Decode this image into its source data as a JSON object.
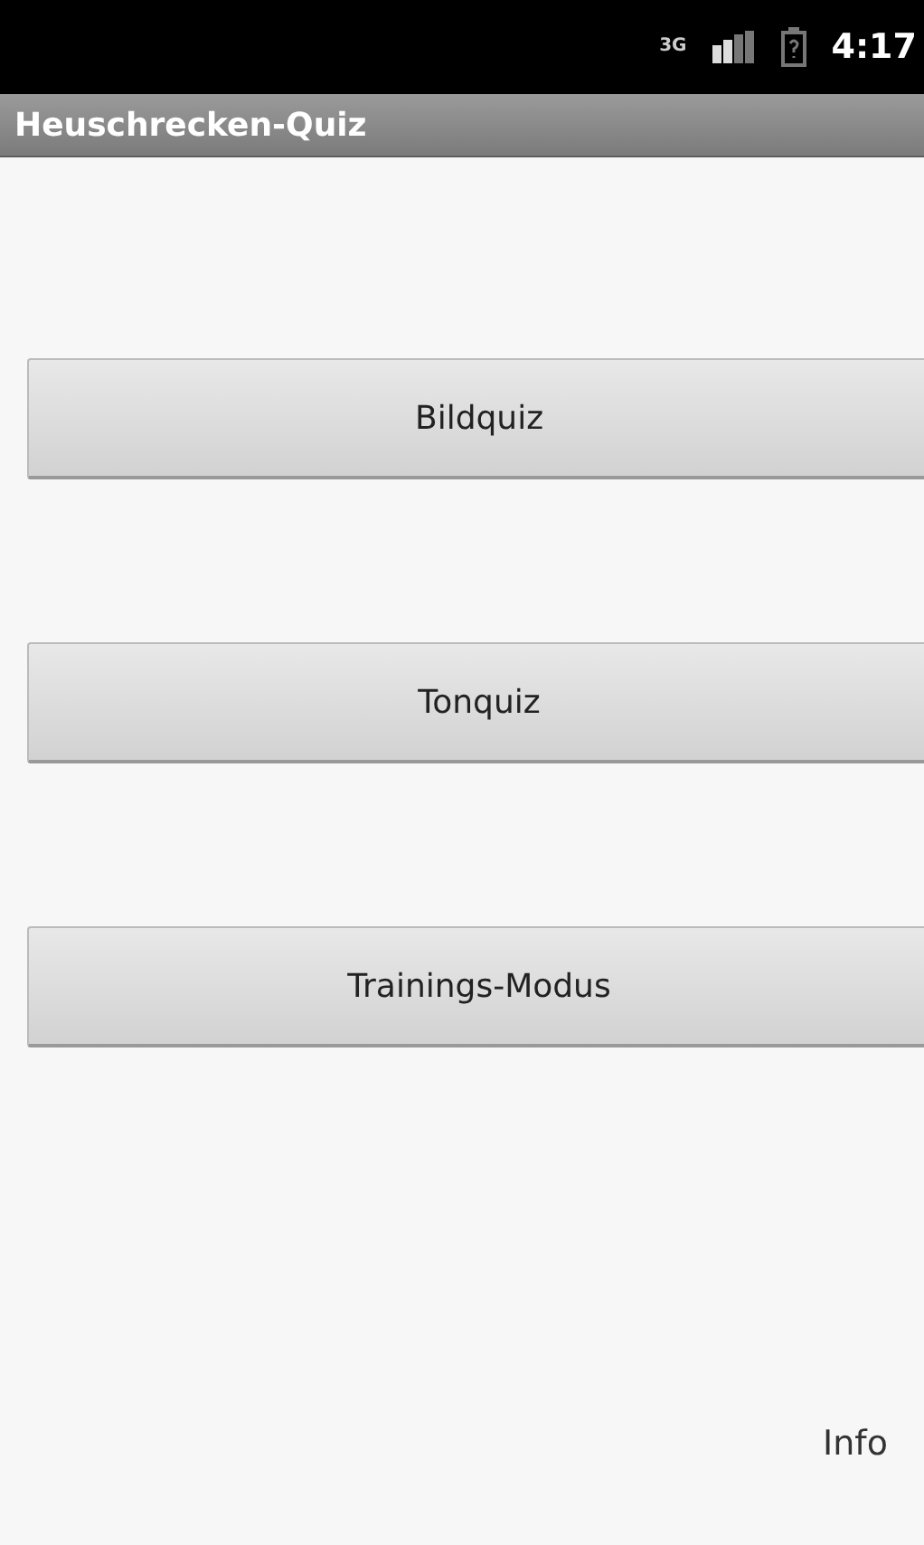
{
  "status_bar": {
    "network": "3G",
    "time": "4:17"
  },
  "title_bar": {
    "title": "Heuschrecken-Quiz"
  },
  "buttons": [
    {
      "label": "Bildquiz"
    },
    {
      "label": "Tonquiz"
    },
    {
      "label": "Trainings-Modus"
    }
  ],
  "info_link": {
    "label": "Info"
  }
}
